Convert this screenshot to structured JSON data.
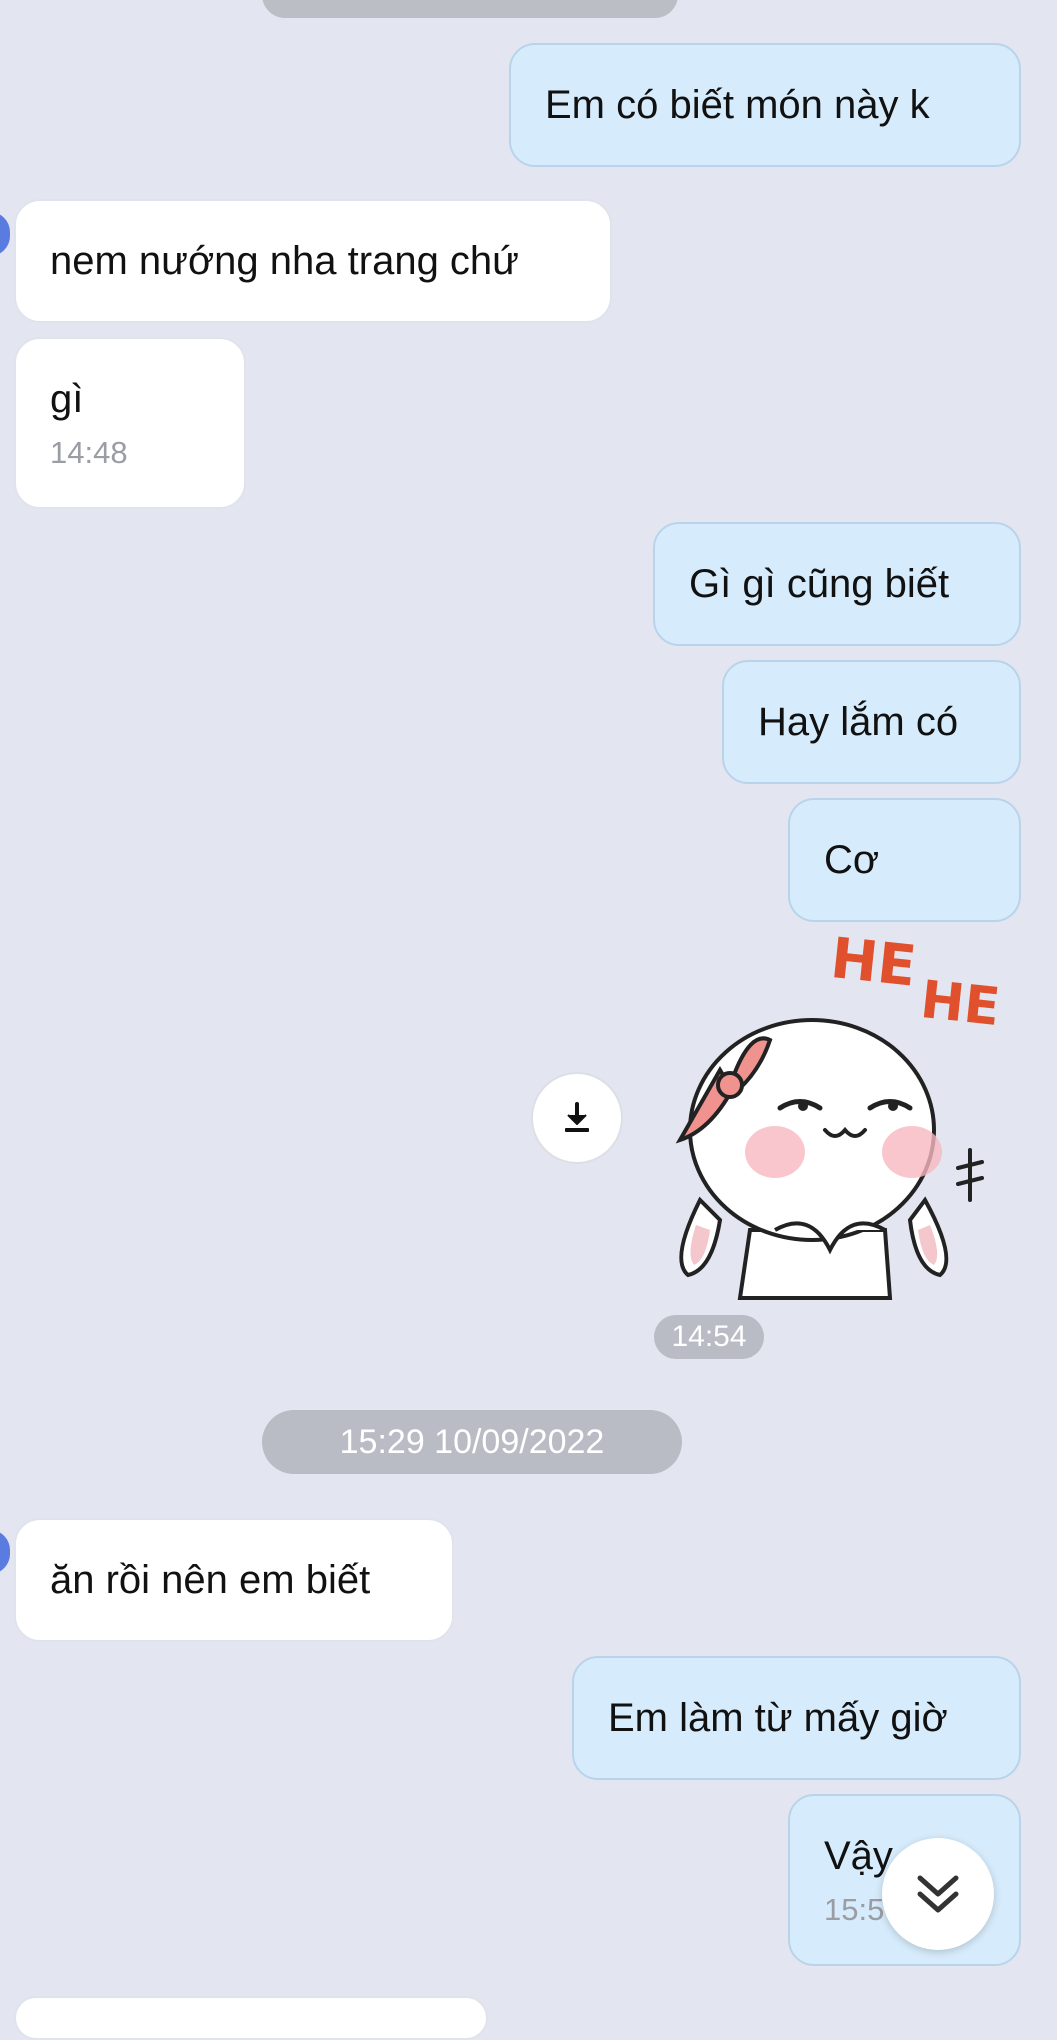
{
  "messages": [
    {
      "id": "m1",
      "direction": "outgoing",
      "text": "Em có biết món này k"
    },
    {
      "id": "m2",
      "direction": "incoming",
      "text": "nem nướng nha trang chứ"
    },
    {
      "id": "m3",
      "direction": "incoming",
      "text": "gì",
      "time": "14:48"
    },
    {
      "id": "m4",
      "direction": "outgoing",
      "text": "Gì gì cũng biết"
    },
    {
      "id": "m5",
      "direction": "outgoing",
      "text": "Hay lắm có"
    },
    {
      "id": "m6",
      "direction": "outgoing",
      "text": "Cơ"
    },
    {
      "id": "m7",
      "direction": "incoming",
      "text": "ăn rồi nên em biết"
    },
    {
      "id": "m8",
      "direction": "outgoing",
      "text": "Em làm từ mấy giờ"
    },
    {
      "id": "m9",
      "direction": "outgoing",
      "text": "Vậy",
      "time": "15:5"
    }
  ],
  "sticker": {
    "caption_text": "HE HE",
    "icon": "bunny-sticker-icon",
    "time": "14:54"
  },
  "date_divider": "15:29 10/09/2022",
  "icons": {
    "download": "download-icon",
    "scroll_down": "double-chevron-down-icon"
  },
  "colors": {
    "background": "#e3e6f0",
    "outgoing_bubble": "#d6ebfb",
    "incoming_bubble": "#ffffff",
    "pill": "#b9bcc4",
    "sticker_text": "#e0502c",
    "avatar_edge": "#5a7be0"
  }
}
